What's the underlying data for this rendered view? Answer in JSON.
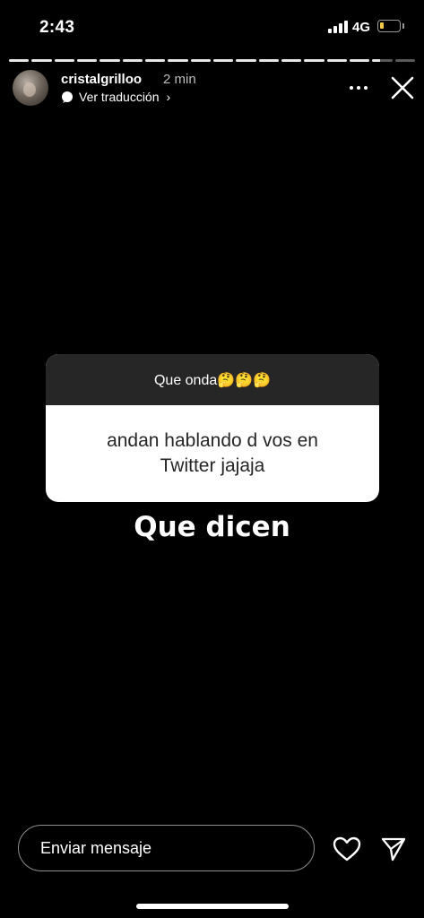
{
  "status_bar": {
    "time": "2:43",
    "network": "4G",
    "battery_level": 0.15,
    "battery_color": "#f2c94c"
  },
  "story": {
    "segments_total": 18,
    "segments_viewed": 16,
    "current_segment_progress": 0.4
  },
  "header": {
    "username": "cristalgrilloo",
    "time_ago": "2 min",
    "translate_label": "Ver traducción",
    "translate_chevron": "›",
    "icons": [
      "avatar",
      "translate-icon",
      "more-options-icon",
      "close-icon"
    ]
  },
  "question_box": {
    "title": "Que onda🤔🤔🤔",
    "answer": "andan hablando d vos en Twitter jajaja",
    "header_color": "#262626"
  },
  "caption": "Que dicen",
  "footer": {
    "message_placeholder": "Enviar mensaje",
    "icons": [
      "heart-icon",
      "send-icon"
    ]
  }
}
